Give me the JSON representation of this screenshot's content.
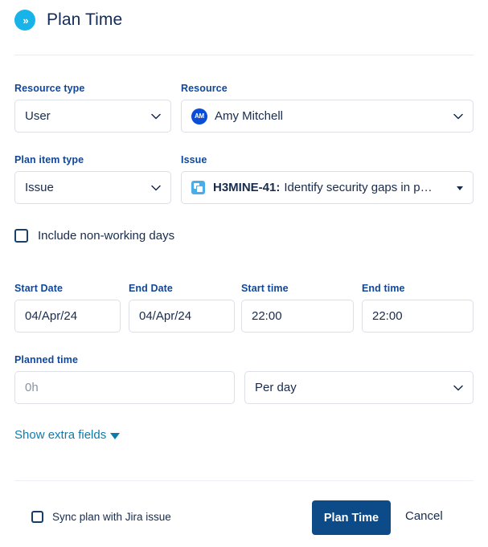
{
  "header": {
    "icon": "double-chevron-right-icon",
    "title": "Plan Time",
    "icon_glyph": "»",
    "accent_color": "#18b4e9"
  },
  "form": {
    "resource_type": {
      "label": "Resource type",
      "value": "User"
    },
    "resource": {
      "label": "Resource",
      "value": "Amy Mitchell",
      "avatar_initials": "AM",
      "avatar_color": "#0b4dd6"
    },
    "plan_item_type": {
      "label": "Plan item type",
      "value": "Issue"
    },
    "issue": {
      "label": "Issue",
      "key": "H3MINE-41:",
      "summary": "Identify security gaps in p…",
      "icon": "issue-type-icon"
    },
    "include_non_working_days": {
      "label": "Include non-working days",
      "checked": false
    },
    "start_date": {
      "label": "Start Date",
      "value": "04/Apr/24"
    },
    "end_date": {
      "label": "End Date",
      "value": "04/Apr/24"
    },
    "start_time": {
      "label": "Start time",
      "value": "22:00"
    },
    "end_time": {
      "label": "End time",
      "value": "22:00"
    },
    "planned_time": {
      "label": "Planned time",
      "value": "",
      "placeholder": "0h"
    },
    "planned_time_unit": {
      "value": "Per day"
    },
    "show_extra_fields": {
      "label": "Show extra fields",
      "link_color": "#0e7cab"
    }
  },
  "footer": {
    "sync_checkbox": {
      "label": "Sync plan with Jira issue",
      "checked": false
    },
    "submit_label": "Plan Time",
    "cancel_label": "Cancel",
    "submit_color": "#0c4b88"
  }
}
